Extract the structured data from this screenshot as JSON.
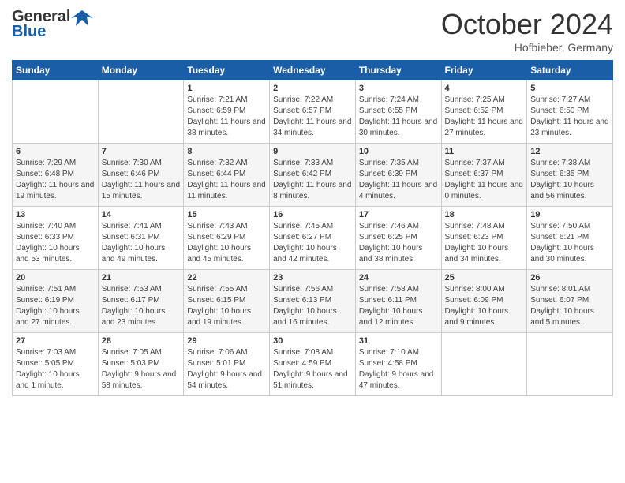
{
  "header": {
    "logo_general": "General",
    "logo_blue": "Blue",
    "month": "October 2024",
    "location": "Hofbieber, Germany"
  },
  "weekdays": [
    "Sunday",
    "Monday",
    "Tuesday",
    "Wednesday",
    "Thursday",
    "Friday",
    "Saturday"
  ],
  "weeks": [
    [
      {
        "day": "",
        "info": ""
      },
      {
        "day": "",
        "info": ""
      },
      {
        "day": "1",
        "info": "Sunrise: 7:21 AM\nSunset: 6:59 PM\nDaylight: 11 hours and 38 minutes."
      },
      {
        "day": "2",
        "info": "Sunrise: 7:22 AM\nSunset: 6:57 PM\nDaylight: 11 hours and 34 minutes."
      },
      {
        "day": "3",
        "info": "Sunrise: 7:24 AM\nSunset: 6:55 PM\nDaylight: 11 hours and 30 minutes."
      },
      {
        "day": "4",
        "info": "Sunrise: 7:25 AM\nSunset: 6:52 PM\nDaylight: 11 hours and 27 minutes."
      },
      {
        "day": "5",
        "info": "Sunrise: 7:27 AM\nSunset: 6:50 PM\nDaylight: 11 hours and 23 minutes."
      }
    ],
    [
      {
        "day": "6",
        "info": "Sunrise: 7:29 AM\nSunset: 6:48 PM\nDaylight: 11 hours and 19 minutes."
      },
      {
        "day": "7",
        "info": "Sunrise: 7:30 AM\nSunset: 6:46 PM\nDaylight: 11 hours and 15 minutes."
      },
      {
        "day": "8",
        "info": "Sunrise: 7:32 AM\nSunset: 6:44 PM\nDaylight: 11 hours and 11 minutes."
      },
      {
        "day": "9",
        "info": "Sunrise: 7:33 AM\nSunset: 6:42 PM\nDaylight: 11 hours and 8 minutes."
      },
      {
        "day": "10",
        "info": "Sunrise: 7:35 AM\nSunset: 6:39 PM\nDaylight: 11 hours and 4 minutes."
      },
      {
        "day": "11",
        "info": "Sunrise: 7:37 AM\nSunset: 6:37 PM\nDaylight: 11 hours and 0 minutes."
      },
      {
        "day": "12",
        "info": "Sunrise: 7:38 AM\nSunset: 6:35 PM\nDaylight: 10 hours and 56 minutes."
      }
    ],
    [
      {
        "day": "13",
        "info": "Sunrise: 7:40 AM\nSunset: 6:33 PM\nDaylight: 10 hours and 53 minutes."
      },
      {
        "day": "14",
        "info": "Sunrise: 7:41 AM\nSunset: 6:31 PM\nDaylight: 10 hours and 49 minutes."
      },
      {
        "day": "15",
        "info": "Sunrise: 7:43 AM\nSunset: 6:29 PM\nDaylight: 10 hours and 45 minutes."
      },
      {
        "day": "16",
        "info": "Sunrise: 7:45 AM\nSunset: 6:27 PM\nDaylight: 10 hours and 42 minutes."
      },
      {
        "day": "17",
        "info": "Sunrise: 7:46 AM\nSunset: 6:25 PM\nDaylight: 10 hours and 38 minutes."
      },
      {
        "day": "18",
        "info": "Sunrise: 7:48 AM\nSunset: 6:23 PM\nDaylight: 10 hours and 34 minutes."
      },
      {
        "day": "19",
        "info": "Sunrise: 7:50 AM\nSunset: 6:21 PM\nDaylight: 10 hours and 30 minutes."
      }
    ],
    [
      {
        "day": "20",
        "info": "Sunrise: 7:51 AM\nSunset: 6:19 PM\nDaylight: 10 hours and 27 minutes."
      },
      {
        "day": "21",
        "info": "Sunrise: 7:53 AM\nSunset: 6:17 PM\nDaylight: 10 hours and 23 minutes."
      },
      {
        "day": "22",
        "info": "Sunrise: 7:55 AM\nSunset: 6:15 PM\nDaylight: 10 hours and 19 minutes."
      },
      {
        "day": "23",
        "info": "Sunrise: 7:56 AM\nSunset: 6:13 PM\nDaylight: 10 hours and 16 minutes."
      },
      {
        "day": "24",
        "info": "Sunrise: 7:58 AM\nSunset: 6:11 PM\nDaylight: 10 hours and 12 minutes."
      },
      {
        "day": "25",
        "info": "Sunrise: 8:00 AM\nSunset: 6:09 PM\nDaylight: 10 hours and 9 minutes."
      },
      {
        "day": "26",
        "info": "Sunrise: 8:01 AM\nSunset: 6:07 PM\nDaylight: 10 hours and 5 minutes."
      }
    ],
    [
      {
        "day": "27",
        "info": "Sunrise: 7:03 AM\nSunset: 5:05 PM\nDaylight: 10 hours and 1 minute."
      },
      {
        "day": "28",
        "info": "Sunrise: 7:05 AM\nSunset: 5:03 PM\nDaylight: 9 hours and 58 minutes."
      },
      {
        "day": "29",
        "info": "Sunrise: 7:06 AM\nSunset: 5:01 PM\nDaylight: 9 hours and 54 minutes."
      },
      {
        "day": "30",
        "info": "Sunrise: 7:08 AM\nSunset: 4:59 PM\nDaylight: 9 hours and 51 minutes."
      },
      {
        "day": "31",
        "info": "Sunrise: 7:10 AM\nSunset: 4:58 PM\nDaylight: 9 hours and 47 minutes."
      },
      {
        "day": "",
        "info": ""
      },
      {
        "day": "",
        "info": ""
      }
    ]
  ]
}
